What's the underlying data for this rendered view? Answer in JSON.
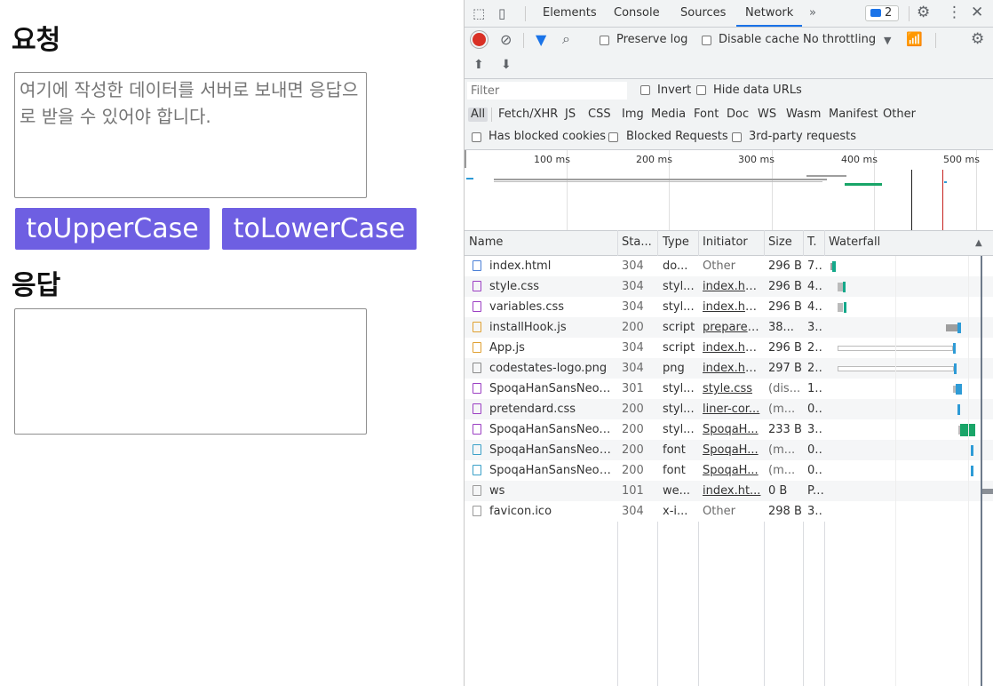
{
  "page": {
    "request_heading": "요청",
    "request_placeholder": "여기에 작성한 데이터를 서버로 보내면 응답으로 받을 수 있어야 합니다.",
    "upper_button": "toUpperCase",
    "lower_button": "toLowerCase",
    "response_heading": "응답",
    "response_value": ""
  },
  "devtools": {
    "tabs": [
      "Elements",
      "Console",
      "Sources",
      "Network"
    ],
    "active_tab": "Network",
    "more_tabs": "»",
    "issues_count": "2",
    "toolbar": {
      "preserve_log": "Preserve log",
      "disable_cache": "Disable cache",
      "throttling": "No throttling"
    },
    "filter_placeholder": "Filter",
    "invert": "Invert",
    "hide_data_urls": "Hide data URLs",
    "types": [
      "All",
      "Fetch/XHR",
      "JS",
      "CSS",
      "Img",
      "Media",
      "Font",
      "Doc",
      "WS",
      "Wasm",
      "Manifest",
      "Other"
    ],
    "blocked_cookies": "Has blocked cookies",
    "blocked_requests": "Blocked Requests",
    "third_party": "3rd-party requests",
    "timeline_ticks": [
      "100 ms",
      "200 ms",
      "300 ms",
      "400 ms",
      "500 ms"
    ],
    "columns": [
      "Name",
      "Sta...",
      "Type",
      "Initiator",
      "Size",
      "T.",
      "Waterfall"
    ],
    "rows": [
      {
        "name": "index.html",
        "status": "304",
        "type": "do...",
        "initiator": "Other",
        "size": "296 B",
        "time": "7...",
        "icon": "doc",
        "link": false
      },
      {
        "name": "style.css",
        "status": "304",
        "type": "styl...",
        "initiator": "index.html",
        "size": "296 B",
        "time": "4...",
        "icon": "css",
        "link": true
      },
      {
        "name": "variables.css",
        "status": "304",
        "type": "styl...",
        "initiator": "index.html",
        "size": "296 B",
        "time": "4...",
        "icon": "css",
        "link": true
      },
      {
        "name": "installHook.js",
        "status": "200",
        "type": "script",
        "initiator": "preparel...",
        "size": "38...",
        "time": "3...",
        "icon": "js",
        "link": true
      },
      {
        "name": "App.js",
        "status": "304",
        "type": "script",
        "initiator": "index.html",
        "size": "296 B",
        "time": "2...",
        "icon": "js",
        "link": true
      },
      {
        "name": "codestates-logo.png",
        "status": "304",
        "type": "png",
        "initiator": "index.html",
        "size": "297 B",
        "time": "2...",
        "icon": "img",
        "link": true
      },
      {
        "name": "SpoqaHanSansNeo....",
        "status": "301",
        "type": "styl...",
        "initiator": "style.css",
        "size": "(dis...",
        "time": "1...",
        "icon": "css",
        "link": true
      },
      {
        "name": "pretendard.css",
        "status": "200",
        "type": "styl...",
        "initiator": "liner-cor...",
        "size": "(m...",
        "time": "0...",
        "icon": "css",
        "link": true
      },
      {
        "name": "SpoqaHanSansNeo....",
        "status": "200",
        "type": "styl...",
        "initiator": "SpoqaH...",
        "size": "233 B",
        "time": "3...",
        "icon": "css",
        "link": true
      },
      {
        "name": "SpoqaHanSansNeo-...",
        "status": "200",
        "type": "font",
        "initiator": "SpoqaH...",
        "size": "(m...",
        "time": "0...",
        "icon": "font",
        "link": true
      },
      {
        "name": "SpoqaHanSansNeo-...",
        "status": "200",
        "type": "font",
        "initiator": "SpoqaH...",
        "size": "(m...",
        "time": "0...",
        "icon": "font",
        "link": true
      },
      {
        "name": "ws",
        "status": "101",
        "type": "we...",
        "initiator": "index.ht...",
        "size": "0 B",
        "time": "P...",
        "icon": "other",
        "link": true
      },
      {
        "name": "favicon.ico",
        "status": "304",
        "type": "x-i...",
        "initiator": "Other",
        "size": "298 B",
        "time": "3...",
        "icon": "other",
        "link": false
      }
    ]
  }
}
